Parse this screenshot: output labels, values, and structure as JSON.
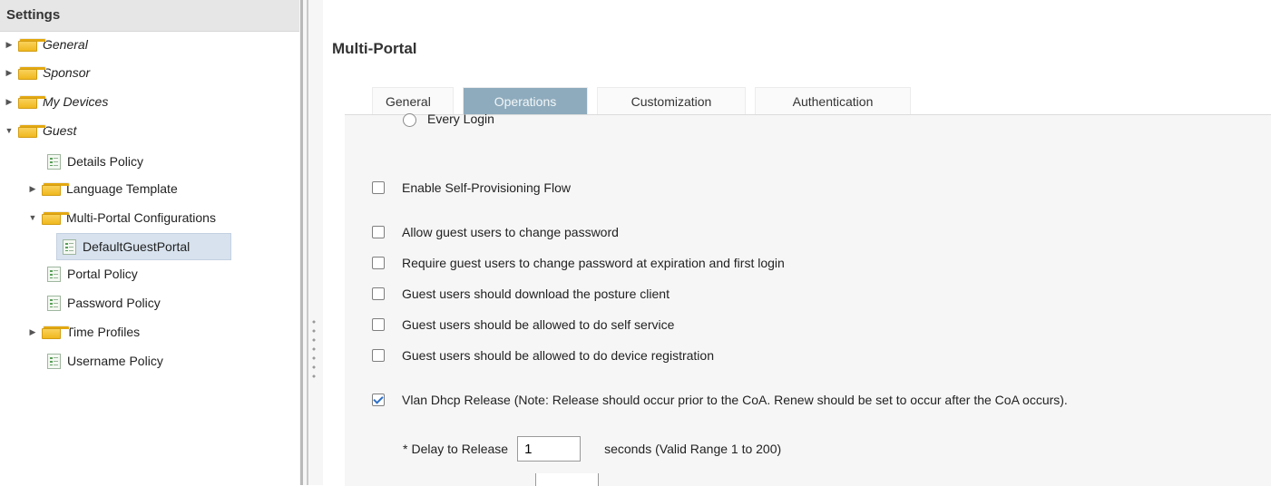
{
  "tree": {
    "title": "Settings",
    "items": [
      {
        "label": "General"
      },
      {
        "label": "Sponsor"
      },
      {
        "label": "My Devices"
      },
      {
        "label": "Guest"
      },
      {
        "label": "Details Policy"
      },
      {
        "label": "Language Template"
      },
      {
        "label": "Multi-Portal Configurations"
      },
      {
        "label": "DefaultGuestPortal"
      },
      {
        "label": "Portal Policy"
      },
      {
        "label": "Password Policy"
      },
      {
        "label": "Time Profiles"
      },
      {
        "label": "Username Policy"
      }
    ]
  },
  "content": {
    "title": "Multi-Portal",
    "tabs": [
      {
        "label": "General"
      },
      {
        "label": "Operations"
      },
      {
        "label": "Customization"
      },
      {
        "label": "Authentication"
      }
    ],
    "active_tab": "Operations",
    "radio_partial": "Every Login",
    "options": [
      {
        "label": "Enable Self-Provisioning Flow",
        "checked": false
      },
      {
        "label": "Allow guest users to change password",
        "checked": false
      },
      {
        "label": "Require guest users to change password at expiration and first login",
        "checked": false
      },
      {
        "label": "Guest users should download the posture client",
        "checked": false
      },
      {
        "label": "Guest users should be allowed to do self service",
        "checked": false
      },
      {
        "label": "Guest users should be allowed to do device registration",
        "checked": false
      },
      {
        "label": "Vlan Dhcp Release (Note: Release should occur prior to the CoA. Renew should be set to occur after the CoA occurs).",
        "checked": true
      }
    ],
    "delay": {
      "required_mark": "*",
      "label": "Delay to Release",
      "value": "1",
      "suffix": "seconds (Valid Range 1 to 200)"
    }
  },
  "colors": {
    "active_tab_bg": "#8eabbd",
    "selected_tree_bg": "#d7e2ee",
    "folder": "#f0b81f",
    "panel_bg": "#f6f6f6"
  }
}
